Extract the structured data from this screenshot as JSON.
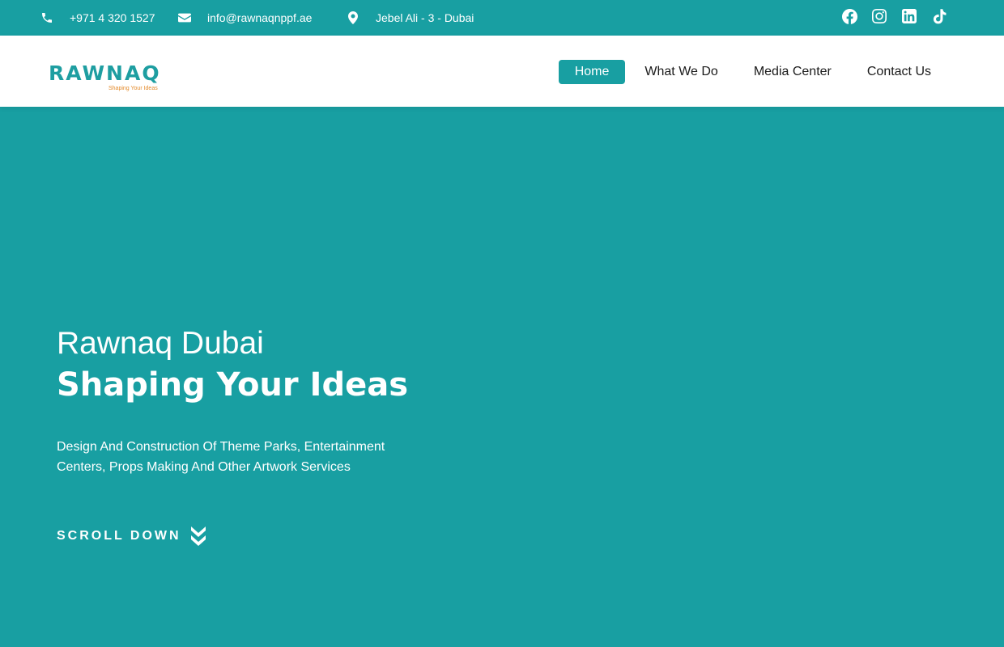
{
  "topbar": {
    "phone": "+971 4 320 1527",
    "email": "info@rawnaqnppf.ae",
    "location": "Jebel Ali - 3 - Dubai",
    "social": [
      "facebook-icon",
      "instagram-icon",
      "linkedin-icon",
      "tiktok-icon"
    ]
  },
  "logo": {
    "wordmark": "RAWNAQ",
    "tagline": "Shaping Your Ideas"
  },
  "nav": {
    "items": [
      "Home",
      "What We Do",
      "Media Center",
      "Contact Us"
    ],
    "active": "Home"
  },
  "hero": {
    "title": "Rawnaq Dubai",
    "subtitle": "Shaping Your Ideas",
    "description": "Design And Construction Of Theme Parks, Entertainment Centers, Props Making And Other Artwork Services",
    "scroll_label": "SCROLL DOWN"
  },
  "colors": {
    "primary": "#189fa2",
    "accent": "#e48b2c",
    "white": "#ffffff"
  }
}
